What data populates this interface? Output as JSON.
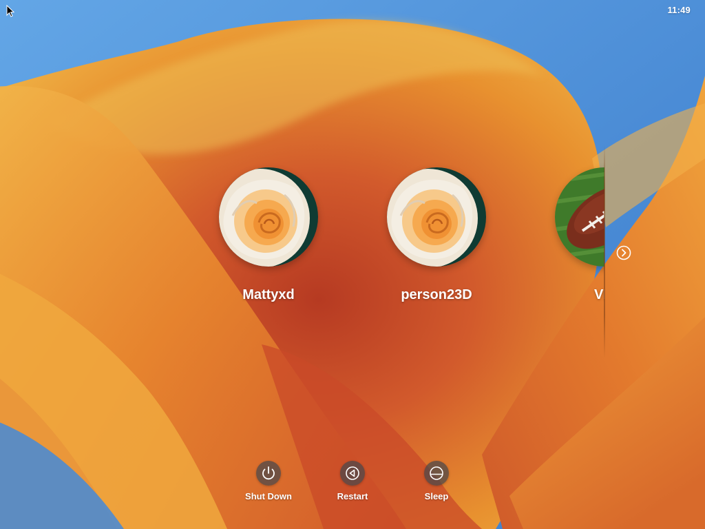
{
  "status_bar": {
    "time": "11:49"
  },
  "users": [
    {
      "name": "Mattyxd",
      "avatar": "rose-icon"
    },
    {
      "name": "person23D",
      "avatar": "rose-icon"
    },
    {
      "name": "VM",
      "avatar": "football-icon"
    }
  ],
  "navigation": {
    "next_icon": "chevron-right-icon"
  },
  "power_options": [
    {
      "label": "Shut Down",
      "icon": "power-icon"
    },
    {
      "label": "Restart",
      "icon": "restart-icon"
    },
    {
      "label": "Sleep",
      "icon": "sleep-icon"
    }
  ],
  "colors": {
    "sky_blue": "#4f8fd6",
    "petal_orange": "#e8892e",
    "petal_red": "#c9432a",
    "petal_yellow": "#f2b84a"
  }
}
